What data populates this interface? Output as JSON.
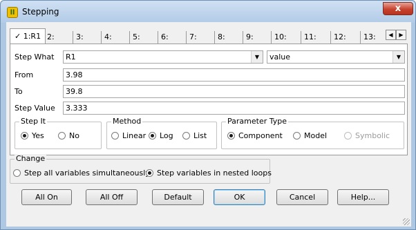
{
  "window": {
    "title": "Stepping",
    "app_icon_glyph": "ll",
    "close_glyph": "x"
  },
  "tabs": [
    {
      "label": "1:R1",
      "check": "✓",
      "active": true
    },
    {
      "label": "2:"
    },
    {
      "label": "3:"
    },
    {
      "label": "4:"
    },
    {
      "label": "5:"
    },
    {
      "label": "6:"
    },
    {
      "label": "7:"
    },
    {
      "label": "8:"
    },
    {
      "label": "9:"
    },
    {
      "label": "10:"
    },
    {
      "label": "11:"
    },
    {
      "label": "12:"
    },
    {
      "label": "13:"
    }
  ],
  "tab_scroll": {
    "left_glyph": "◀",
    "right_glyph": "▶"
  },
  "step_what": {
    "label": "Step What",
    "value": "R1",
    "param_value": "value",
    "arrow_glyph": "▼"
  },
  "from": {
    "label": "From",
    "value": "3.98"
  },
  "to": {
    "label": "To",
    "value": "39.8"
  },
  "step_value": {
    "label": "Step Value",
    "value": "3.333"
  },
  "step_it": {
    "title": "Step It",
    "options": [
      {
        "label": "Yes",
        "selected": true
      },
      {
        "label": "No",
        "selected": false
      }
    ]
  },
  "method": {
    "title": "Method",
    "options": [
      {
        "label": "Linear",
        "selected": false
      },
      {
        "label": "Log",
        "selected": true
      },
      {
        "label": "List",
        "selected": false
      }
    ]
  },
  "parameter_type": {
    "title": "Parameter Type",
    "options": [
      {
        "label": "Component",
        "selected": true
      },
      {
        "label": "Model",
        "selected": false
      },
      {
        "label": "Symbolic",
        "selected": false,
        "disabled": true
      }
    ]
  },
  "change": {
    "title": "Change",
    "options": [
      {
        "label": "Step all variables simultaneously",
        "selected": false
      },
      {
        "label": "Step variables in nested loops",
        "selected": true
      }
    ]
  },
  "buttons": {
    "all_on": "All On",
    "all_off": "All Off",
    "default": "Default",
    "ok": "OK",
    "cancel": "Cancel",
    "help": "Help..."
  }
}
